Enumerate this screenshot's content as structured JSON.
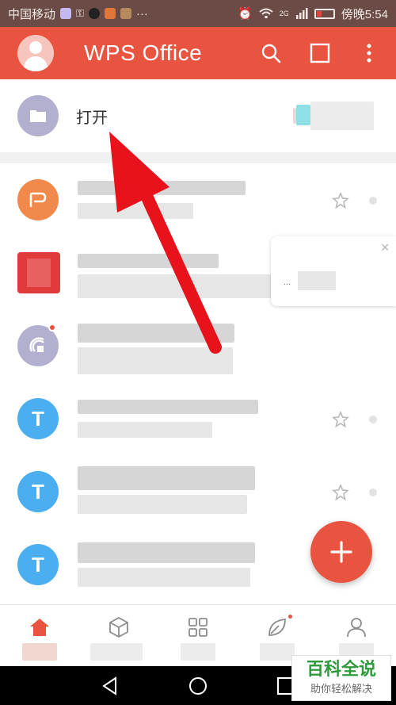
{
  "status_bar": {
    "carrier": "中国移动",
    "network": "2G",
    "time": "傍晚5:54"
  },
  "app_bar": {
    "title": "WPS Office",
    "icons": [
      "avatar-icon",
      "search-icon",
      "multi-window-icon",
      "more-vert-icon"
    ]
  },
  "open_row": {
    "label": "打开",
    "icon": "folder-icon"
  },
  "list": {
    "items": [
      {
        "icon": "pdf-p-icon",
        "letter": "P",
        "color": "#f0894b",
        "starred": false
      },
      {
        "icon": "image-thumbnail",
        "letter": "",
        "color": "#e03b3b",
        "starred": false
      },
      {
        "icon": "satellite-icon",
        "letter": "",
        "color": "#b3b0cf",
        "starred": false,
        "badge": true
      },
      {
        "icon": "text-t-icon",
        "letter": "T",
        "color": "#4aaef0",
        "starred": false
      },
      {
        "icon": "text-t-icon",
        "letter": "T",
        "color": "#4aaef0",
        "starred": false
      },
      {
        "icon": "text-t-icon",
        "letter": "T",
        "color": "#4aaef0",
        "starred": false
      }
    ]
  },
  "popup": {
    "ellipsis": "..."
  },
  "fab": {
    "icon": "plus-icon"
  },
  "bottom_nav": {
    "items": [
      {
        "icon": "home-icon",
        "active": true
      },
      {
        "icon": "cube-icon",
        "active": false
      },
      {
        "icon": "apps-grid-icon",
        "active": false
      },
      {
        "icon": "leaf-icon",
        "active": false,
        "badge": true
      },
      {
        "icon": "person-icon",
        "active": false
      }
    ]
  },
  "watermark": {
    "title": "百科全说",
    "subtitle": "助你轻松解决"
  },
  "colors": {
    "accent": "#e8543f",
    "status_bar": "#6b4b45",
    "annotation_arrow": "#e8121c"
  }
}
